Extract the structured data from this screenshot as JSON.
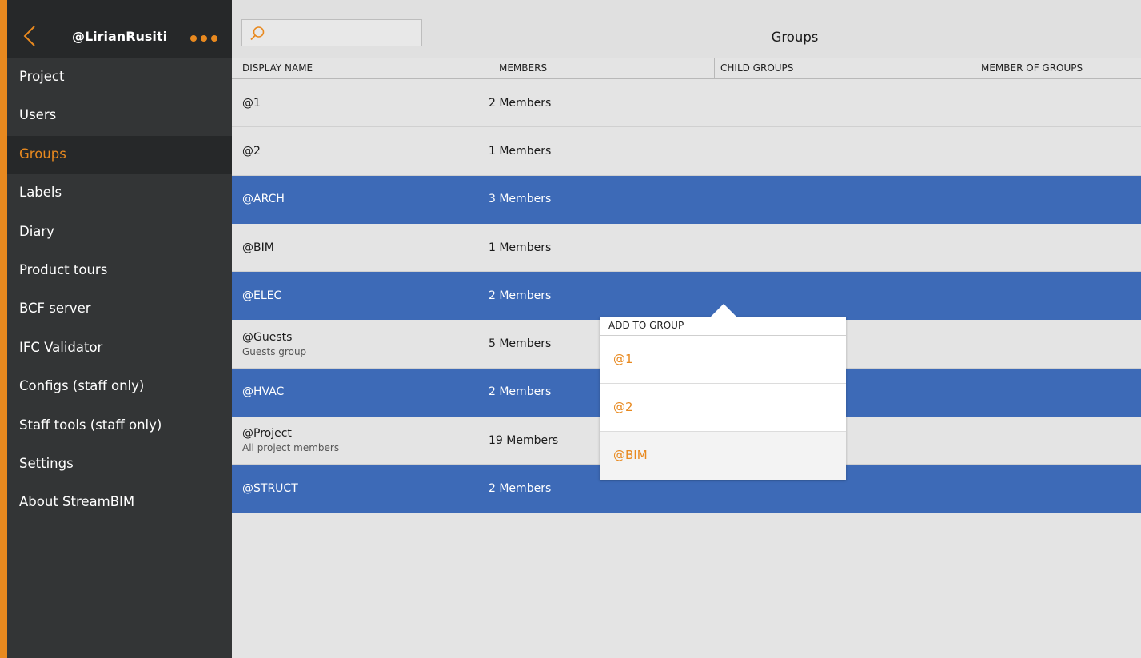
{
  "sidebar": {
    "username": "@LirianRusiti",
    "items": [
      {
        "label": "Project"
      },
      {
        "label": "Users"
      },
      {
        "label": "Groups",
        "active": true
      },
      {
        "label": "Labels"
      },
      {
        "label": "Diary"
      },
      {
        "label": "Product tours"
      },
      {
        "label": "BCF server"
      },
      {
        "label": "IFC Validator"
      },
      {
        "label": "Configs (staff only)"
      },
      {
        "label": "Staff tools (staff only)"
      },
      {
        "label": "Settings"
      },
      {
        "label": "About StreamBIM"
      }
    ]
  },
  "header": {
    "title": "Groups",
    "search": {
      "value": "",
      "placeholder": ""
    }
  },
  "table": {
    "columns": [
      "DISPLAY NAME",
      "MEMBERS",
      "CHILD GROUPS",
      "MEMBER OF GROUPS"
    ],
    "rows": [
      {
        "name": "@1",
        "subtitle": "",
        "members": "2 Members",
        "selected": false
      },
      {
        "name": "@2",
        "subtitle": "",
        "members": "1 Members",
        "selected": false
      },
      {
        "name": "@ARCH",
        "subtitle": "",
        "members": "3 Members",
        "selected": true
      },
      {
        "name": "@BIM",
        "subtitle": "",
        "members": "1 Members",
        "selected": false
      },
      {
        "name": "@ELEC",
        "subtitle": "",
        "members": "2 Members",
        "selected": true
      },
      {
        "name": "@Guests",
        "subtitle": "Guests group",
        "members": "5 Members",
        "selected": false
      },
      {
        "name": "@HVAC",
        "subtitle": "",
        "members": "2 Members",
        "selected": true
      },
      {
        "name": "@Project",
        "subtitle": "All project members",
        "members": "19 Members",
        "selected": false
      },
      {
        "name": "@STRUCT",
        "subtitle": "",
        "members": "2 Members",
        "selected": true
      }
    ]
  },
  "popup": {
    "title": "ADD TO GROUP",
    "items": [
      "@1",
      "@2",
      "@BIM"
    ]
  },
  "colors": {
    "accent": "#e8891f",
    "selected_row": "#3d6ab7",
    "sidebar_bg": "#333536"
  }
}
